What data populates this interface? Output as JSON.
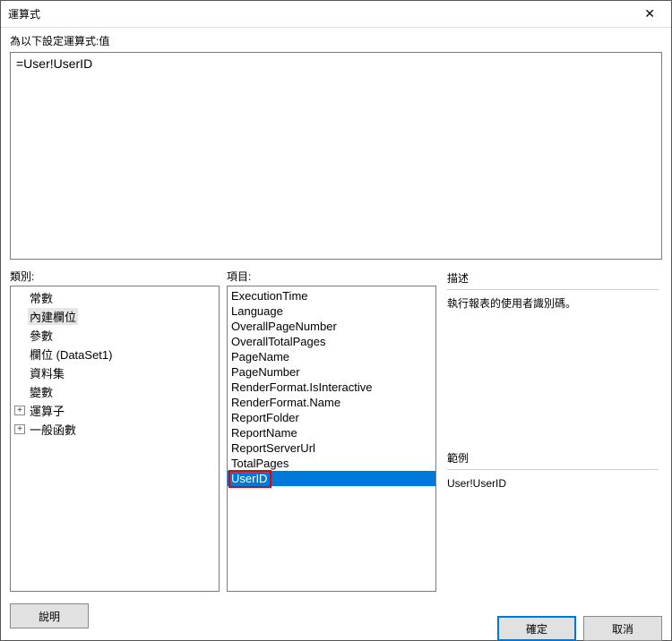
{
  "titlebar": {
    "title": "運算式"
  },
  "prompt": "為以下設定運算式:值",
  "expression": "=User!UserID",
  "labels": {
    "category": "類別:",
    "items": "項目:",
    "description_heading": "描述",
    "example_heading": "範例"
  },
  "categories": {
    "items": [
      {
        "label": "常數",
        "indent": 1
      },
      {
        "label": "內建欄位",
        "indent": 1,
        "selected": true
      },
      {
        "label": "參數",
        "indent": 1
      },
      {
        "label": "欄位 (DataSet1)",
        "indent": 1
      },
      {
        "label": "資料集",
        "indent": 1
      },
      {
        "label": "變數",
        "indent": 1
      },
      {
        "label": "運算子",
        "indent": 0,
        "toggle": "+"
      },
      {
        "label": "一般函數",
        "indent": 0,
        "toggle": "+"
      }
    ]
  },
  "items": [
    "ExecutionTime",
    "Language",
    "OverallPageNumber",
    "OverallTotalPages",
    "PageName",
    "PageNumber",
    "RenderFormat.IsInteractive",
    "RenderFormat.Name",
    "ReportFolder",
    "ReportName",
    "ReportServerUrl",
    "TotalPages",
    "UserID"
  ],
  "selected_item_index": 12,
  "description": "執行報表的使用者識別碼。",
  "example": "User!UserID",
  "footer": {
    "help": "說明",
    "ok": "確定",
    "cancel": "取消"
  }
}
